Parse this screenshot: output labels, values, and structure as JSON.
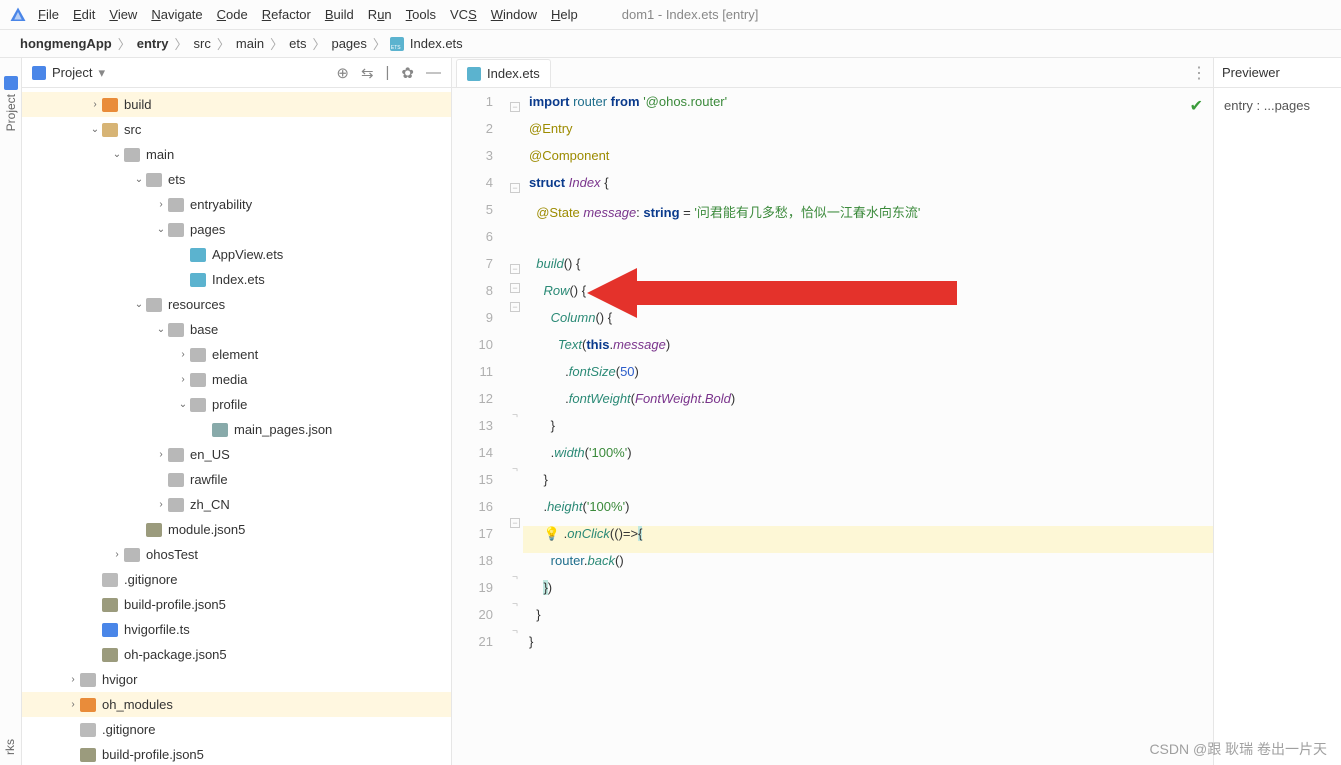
{
  "window_title": "dom1 - Index.ets [entry]",
  "menu": {
    "items": [
      {
        "mn": "F",
        "rest": "ile"
      },
      {
        "mn": "E",
        "rest": "dit"
      },
      {
        "mn": "V",
        "rest": "iew"
      },
      {
        "mn": "N",
        "rest": "avigate"
      },
      {
        "mn": "C",
        "rest": "ode"
      },
      {
        "mn": "R",
        "rest": "efactor"
      },
      {
        "mn": "B",
        "rest": "uild"
      },
      {
        "mn": "R",
        "rest": "un",
        "pre": "",
        "u": "u"
      },
      {
        "mn": "T",
        "rest": "ools"
      },
      {
        "mn": "S",
        "rest": "",
        "pre": "VC"
      },
      {
        "mn": "W",
        "rest": "indow"
      },
      {
        "mn": "H",
        "rest": "elp"
      }
    ]
  },
  "breadcrumb": [
    "hongmengApp",
    "entry",
    "src",
    "main",
    "ets",
    "pages",
    "Index.ets"
  ],
  "left_tab": {
    "label": "Project",
    "bottom_label": "rks"
  },
  "project_header": {
    "label": "Project"
  },
  "tree": [
    {
      "depth": 3,
      "arrow": ">",
      "icon": "folder-orange",
      "label": "build",
      "hl": true
    },
    {
      "depth": 3,
      "arrow": "v",
      "icon": "folder",
      "label": "src"
    },
    {
      "depth": 4,
      "arrow": "v",
      "icon": "folder-grey",
      "label": "main"
    },
    {
      "depth": 5,
      "arrow": "v",
      "icon": "folder-grey",
      "label": "ets"
    },
    {
      "depth": 6,
      "arrow": ">",
      "icon": "folder-grey",
      "label": "entryability"
    },
    {
      "depth": 6,
      "arrow": "v",
      "icon": "folder-grey",
      "label": "pages"
    },
    {
      "depth": 7,
      "arrow": "",
      "icon": "file-ets",
      "label": "AppView.ets"
    },
    {
      "depth": 7,
      "arrow": "",
      "icon": "file-ets",
      "label": "Index.ets"
    },
    {
      "depth": 5,
      "arrow": "v",
      "icon": "folder-grey",
      "label": "resources"
    },
    {
      "depth": 6,
      "arrow": "v",
      "icon": "folder-grey",
      "label": "base"
    },
    {
      "depth": 7,
      "arrow": ">",
      "icon": "folder-grey",
      "label": "element"
    },
    {
      "depth": 7,
      "arrow": ">",
      "icon": "folder-grey",
      "label": "media"
    },
    {
      "depth": 7,
      "arrow": "v",
      "icon": "folder-grey",
      "label": "profile"
    },
    {
      "depth": 8,
      "arrow": "",
      "icon": "file-json",
      "label": "main_pages.json"
    },
    {
      "depth": 6,
      "arrow": ">",
      "icon": "folder-grey",
      "label": "en_US"
    },
    {
      "depth": 6,
      "arrow": "",
      "icon": "folder-grey",
      "label": "rawfile"
    },
    {
      "depth": 6,
      "arrow": ">",
      "icon": "folder-grey",
      "label": "zh_CN"
    },
    {
      "depth": 5,
      "arrow": "",
      "icon": "file-json5",
      "label": "module.json5"
    },
    {
      "depth": 4,
      "arrow": ">",
      "icon": "folder-grey",
      "label": "ohosTest"
    },
    {
      "depth": 3,
      "arrow": "",
      "icon": "file-git",
      "label": ".gitignore"
    },
    {
      "depth": 3,
      "arrow": "",
      "icon": "file-json5",
      "label": "build-profile.json5"
    },
    {
      "depth": 3,
      "arrow": "",
      "icon": "file-ts",
      "label": "hvigorfile.ts"
    },
    {
      "depth": 3,
      "arrow": "",
      "icon": "file-json5",
      "label": "oh-package.json5"
    },
    {
      "depth": 2,
      "arrow": ">",
      "icon": "folder-grey",
      "label": "hvigor"
    },
    {
      "depth": 2,
      "arrow": ">",
      "icon": "folder-orange",
      "label": "oh_modules",
      "hl": true
    },
    {
      "depth": 2,
      "arrow": "",
      "icon": "file-git",
      "label": ".gitignore"
    },
    {
      "depth": 2,
      "arrow": "",
      "icon": "file-json5",
      "label": "build-profile.json5"
    }
  ],
  "editor": {
    "tab_label": "Index.ets",
    "line_count": 21,
    "code": {
      "l1": {
        "import": "import",
        "router": "router",
        "from": "from",
        "str": "'@ohos.router'"
      },
      "l2": {
        "ann": "@Entry"
      },
      "l3": {
        "ann": "@Component"
      },
      "l4": {
        "kw": "struct",
        "name": "Index",
        "brace": "{"
      },
      "l5": {
        "ann": "@State",
        "name": "message",
        "colon": ":",
        "type": "string",
        "eq": "=",
        "str": "'问君能有几多愁，恰似一江春水向东流'"
      },
      "l6": {
        "blank": " "
      },
      "l7": {
        "fn": "build",
        "paren": "()",
        "brace": "{"
      },
      "l8": {
        "fn": "Row",
        "paren": "()",
        "brace": "{"
      },
      "l9": {
        "fn": "Column",
        "paren": "()",
        "brace": "{"
      },
      "l10": {
        "fn": "Text",
        "popen": "(",
        "this": "this",
        "dot": ".",
        "msg": "message",
        "pclose": ")"
      },
      "l11": {
        "dot": ".",
        "fn": "fontSize",
        "popen": "(",
        "num": "50",
        "pclose": ")"
      },
      "l12": {
        "dot": ".",
        "fn": "fontWeight",
        "popen": "(",
        "type": "FontWeight",
        "dot2": ".",
        "prop": "Bold",
        "pclose": ")"
      },
      "l13": {
        "brace": "}"
      },
      "l14": {
        "dot": ".",
        "fn": "width",
        "popen": "(",
        "str": "'100%'",
        "pclose": ")"
      },
      "l15": {
        "brace": "}"
      },
      "l16": {
        "dot": ".",
        "fn": "height",
        "popen": "(",
        "str": "'100%'",
        "pclose": ")"
      },
      "l17": {
        "dot": ".",
        "fn": "onClick",
        "popen": "(",
        "arrow": "()=>",
        "brace": "{"
      },
      "l18": {
        "router": "router",
        "dot": ".",
        "fn": "back",
        "paren": "()"
      },
      "l19": {
        "brace": "}",
        ")": ")"
      },
      "l20": {
        "brace": "}"
      },
      "l21": {
        "brace": "}"
      }
    }
  },
  "previewer": {
    "title": "Previewer",
    "body": "entry : ...pages"
  },
  "watermark": "CSDN @跟 耿瑞 卷出一片天"
}
